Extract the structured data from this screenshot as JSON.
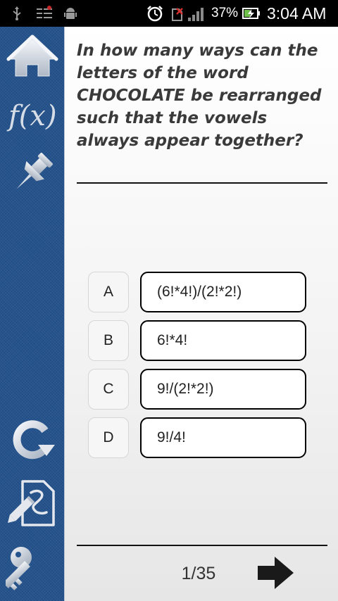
{
  "status_bar": {
    "battery_percent": "37%",
    "time": "3:04 AM",
    "icons": [
      "usb-icon",
      "notification-list-icon",
      "android-debug-icon",
      "alarm-clock-icon",
      "no-sim-icon",
      "signal-icon",
      "battery-charging-icon"
    ]
  },
  "sidebar": {
    "items": [
      {
        "name": "home",
        "icon": "home-icon"
      },
      {
        "name": "formulas",
        "icon": "function-fx-icon",
        "label": "f(x)"
      },
      {
        "name": "pin",
        "icon": "pushpin-icon"
      },
      {
        "name": "refresh",
        "icon": "refresh-icon"
      },
      {
        "name": "notes",
        "icon": "edit-notes-icon"
      },
      {
        "name": "answer-key",
        "icon": "key-icon"
      }
    ]
  },
  "question": {
    "text": "In how many ways can the letters of the word CHOCOLATE be rearranged such that the vowels always appear together?"
  },
  "options": [
    {
      "letter": "A",
      "answer": "(6!*4!)/(2!*2!)"
    },
    {
      "letter": "B",
      "answer": "6!*4!"
    },
    {
      "letter": "C",
      "answer": "9!/(2!*2!)"
    },
    {
      "letter": "D",
      "answer": "9!/4!"
    }
  ],
  "footer": {
    "counter": "1/35",
    "next_icon": "arrow-right-icon"
  },
  "colors": {
    "sidebar": "#25538d",
    "status_bar": "#000000",
    "question_text": "#3a3a3a"
  }
}
